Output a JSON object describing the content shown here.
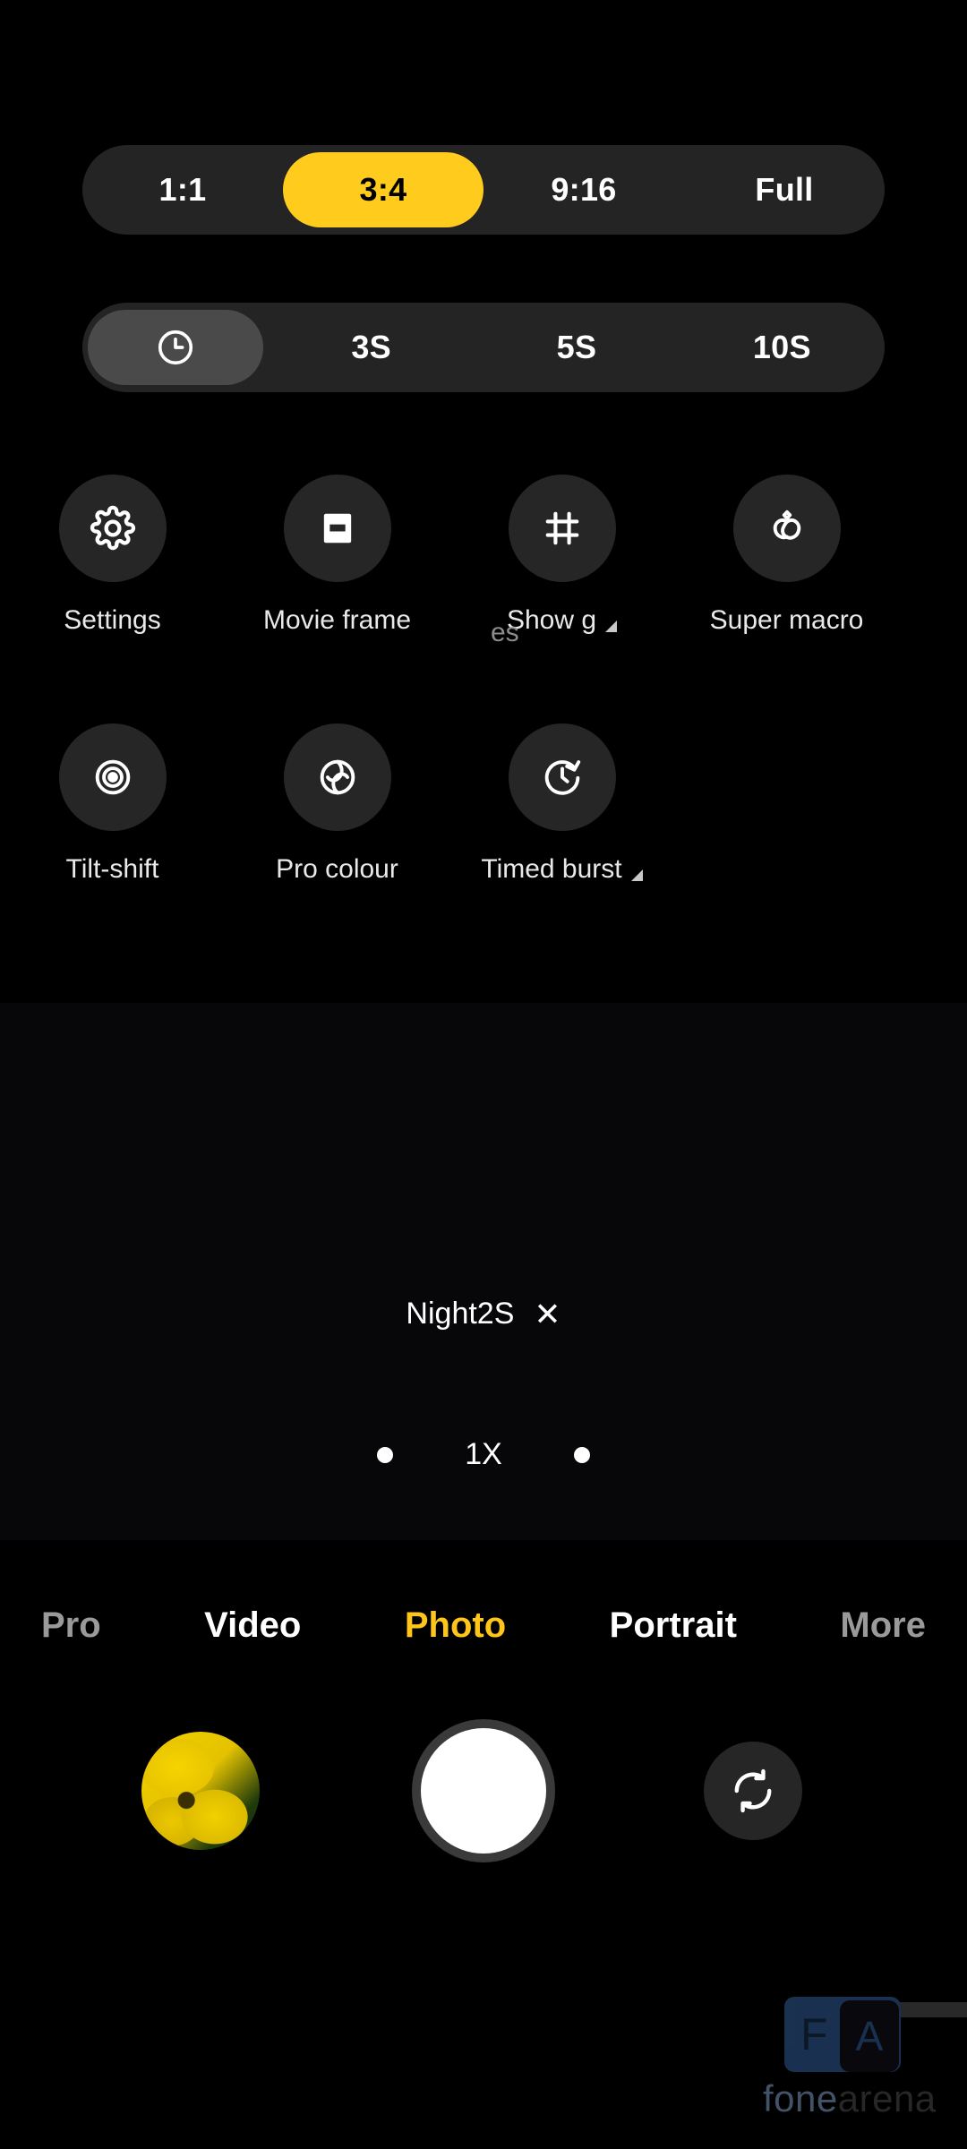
{
  "aspect_bar": {
    "options": [
      {
        "label": "1:1",
        "state": "normal"
      },
      {
        "label": "3:4",
        "state": "selected"
      },
      {
        "label": "9:16",
        "state": "normal"
      },
      {
        "label": "Full",
        "state": "normal"
      }
    ],
    "selected": "3:4",
    "accent_color": "#FFCC1E",
    "track_color": "#242424"
  },
  "timer_bar": {
    "options": [
      {
        "label": "",
        "icon": "clock-icon",
        "state": "selected"
      },
      {
        "label": "3S",
        "state": "normal"
      },
      {
        "label": "5S",
        "state": "normal"
      },
      {
        "label": "10S",
        "state": "normal"
      }
    ],
    "selected": "off",
    "selected_color": "#4a4a4a",
    "track_color": "#242424"
  },
  "tools": {
    "row1": [
      {
        "label": "Settings",
        "icon": "gear-icon",
        "caret": false
      },
      {
        "label": "Movie frame",
        "icon": "movie-frame-icon",
        "caret": false
      },
      {
        "label": "Show g",
        "icon": "grid-icon",
        "caret": true
      },
      {
        "label": "Super macro",
        "icon": "flower-icon",
        "caret": false
      }
    ],
    "row2": [
      {
        "label": "Tilt-shift",
        "icon": "tilt-shift-icon",
        "caret": false
      },
      {
        "label": "Pro colour",
        "icon": "swirl-icon",
        "caret": false
      },
      {
        "label": "Timed burst",
        "icon": "stopwatch-icon",
        "caret": true
      }
    ],
    "ghost_label": "es"
  },
  "preview": {
    "night_mode": {
      "label": "Night2S",
      "close_icon": "close-icon"
    },
    "zoom": {
      "level": "1X",
      "left_dot": "zoom-dot",
      "right_dot": "zoom-dot"
    }
  },
  "modes": [
    {
      "label": "Pro",
      "state": "dim"
    },
    {
      "label": "Video",
      "state": "normal"
    },
    {
      "label": "Photo",
      "state": "active"
    },
    {
      "label": "Portrait",
      "state": "normal"
    },
    {
      "label": "More",
      "state": "dim"
    }
  ],
  "mode_accent": "#FFC518",
  "bottom": {
    "gallery": "gallery-thumbnail",
    "shutter": "shutter-button",
    "flip": "camera-flip-icon"
  },
  "watermark": {
    "badge_f": "F",
    "badge_a": "A",
    "text_first": "fone",
    "text_second": "arena"
  }
}
